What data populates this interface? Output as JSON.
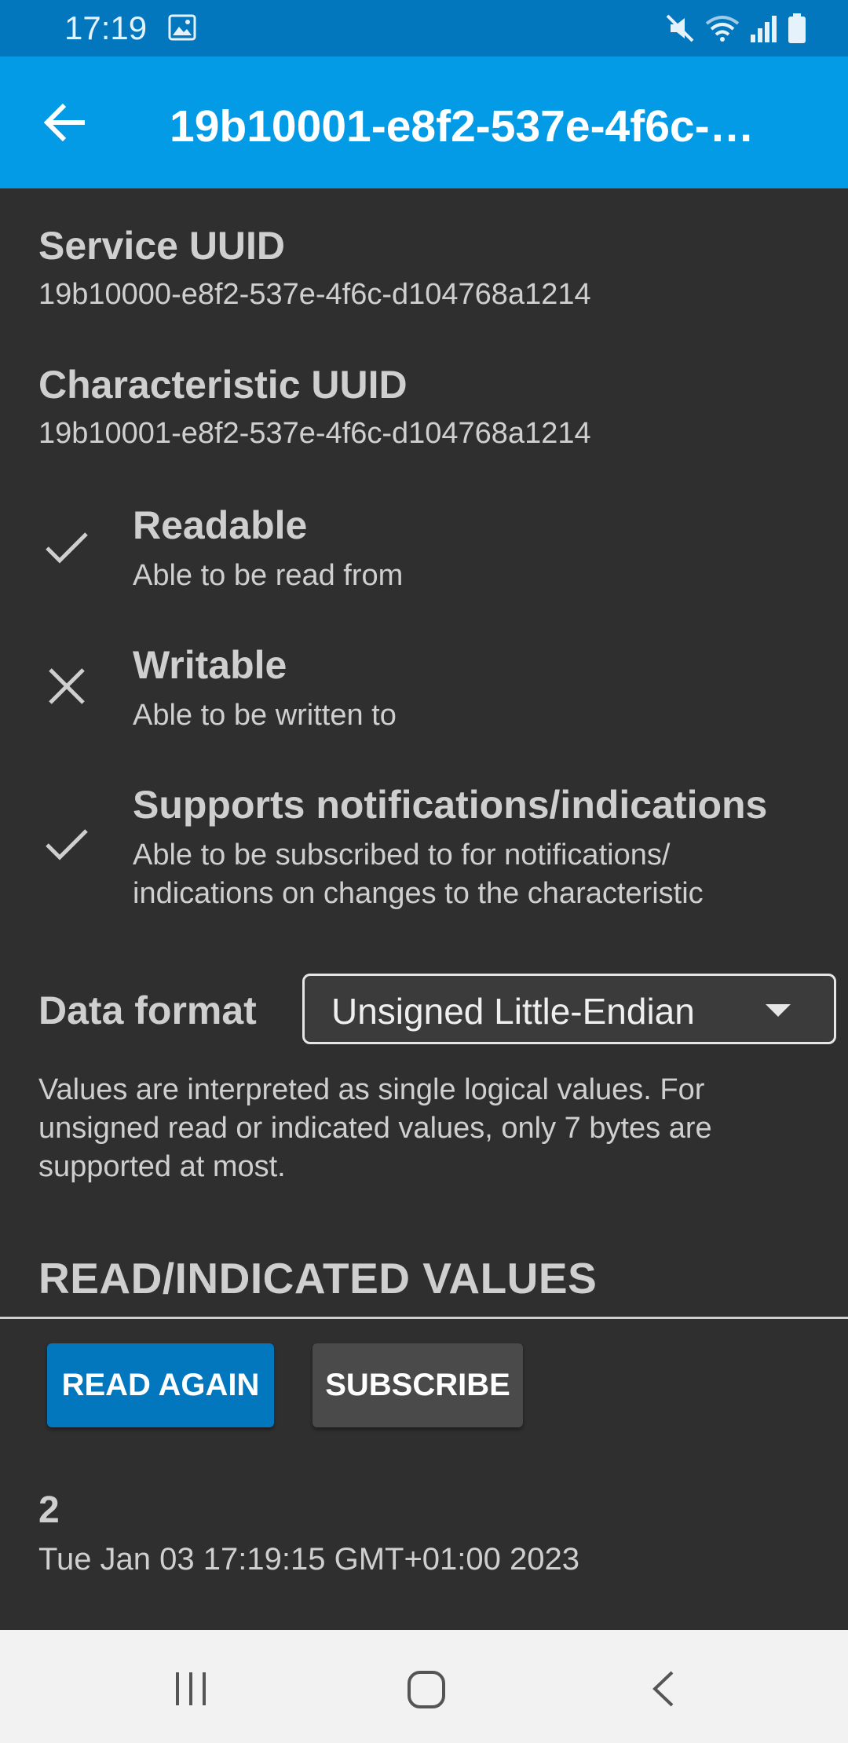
{
  "status_bar": {
    "time": "17:19"
  },
  "app_bar": {
    "title": "19b10001-e8f2-537e-4f6c-…"
  },
  "service": {
    "label": "Service UUID",
    "value": "19b10000-e8f2-537e-4f6c-d104768a1214"
  },
  "characteristic": {
    "label": "Characteristic UUID",
    "value": "19b10001-e8f2-537e-4f6c-d104768a1214"
  },
  "properties": [
    {
      "icon": "check-icon",
      "title": "Readable",
      "description": "Able to be read from"
    },
    {
      "icon": "close-icon",
      "title": "Writable",
      "description": "Able to be written to"
    },
    {
      "icon": "check-icon",
      "title": "Supports notifications/indications",
      "description": "Able to be subscribed to for notifications/ indications on changes to the characteristic"
    }
  ],
  "data_format": {
    "label": "Data format",
    "selected": "Unsigned Little-Endian"
  },
  "format_info": "Values are interpreted as single logical values. For unsigned read or indicated values, only 7 bytes are supported at most.",
  "section_title": "READ/INDICATED VALUES",
  "buttons": {
    "read_again": "READ AGAIN",
    "subscribe": "SUBSCRIBE"
  },
  "reading": {
    "value": "2",
    "timestamp": "Tue Jan 03 17:19:15 GMT+01:00 2023"
  },
  "colors": {
    "status_bar": "#0277bd",
    "app_bar": "#039be5",
    "background": "#2f2f2f",
    "primary_button": "#0277bd",
    "secondary_button": "#4a4a4a"
  }
}
